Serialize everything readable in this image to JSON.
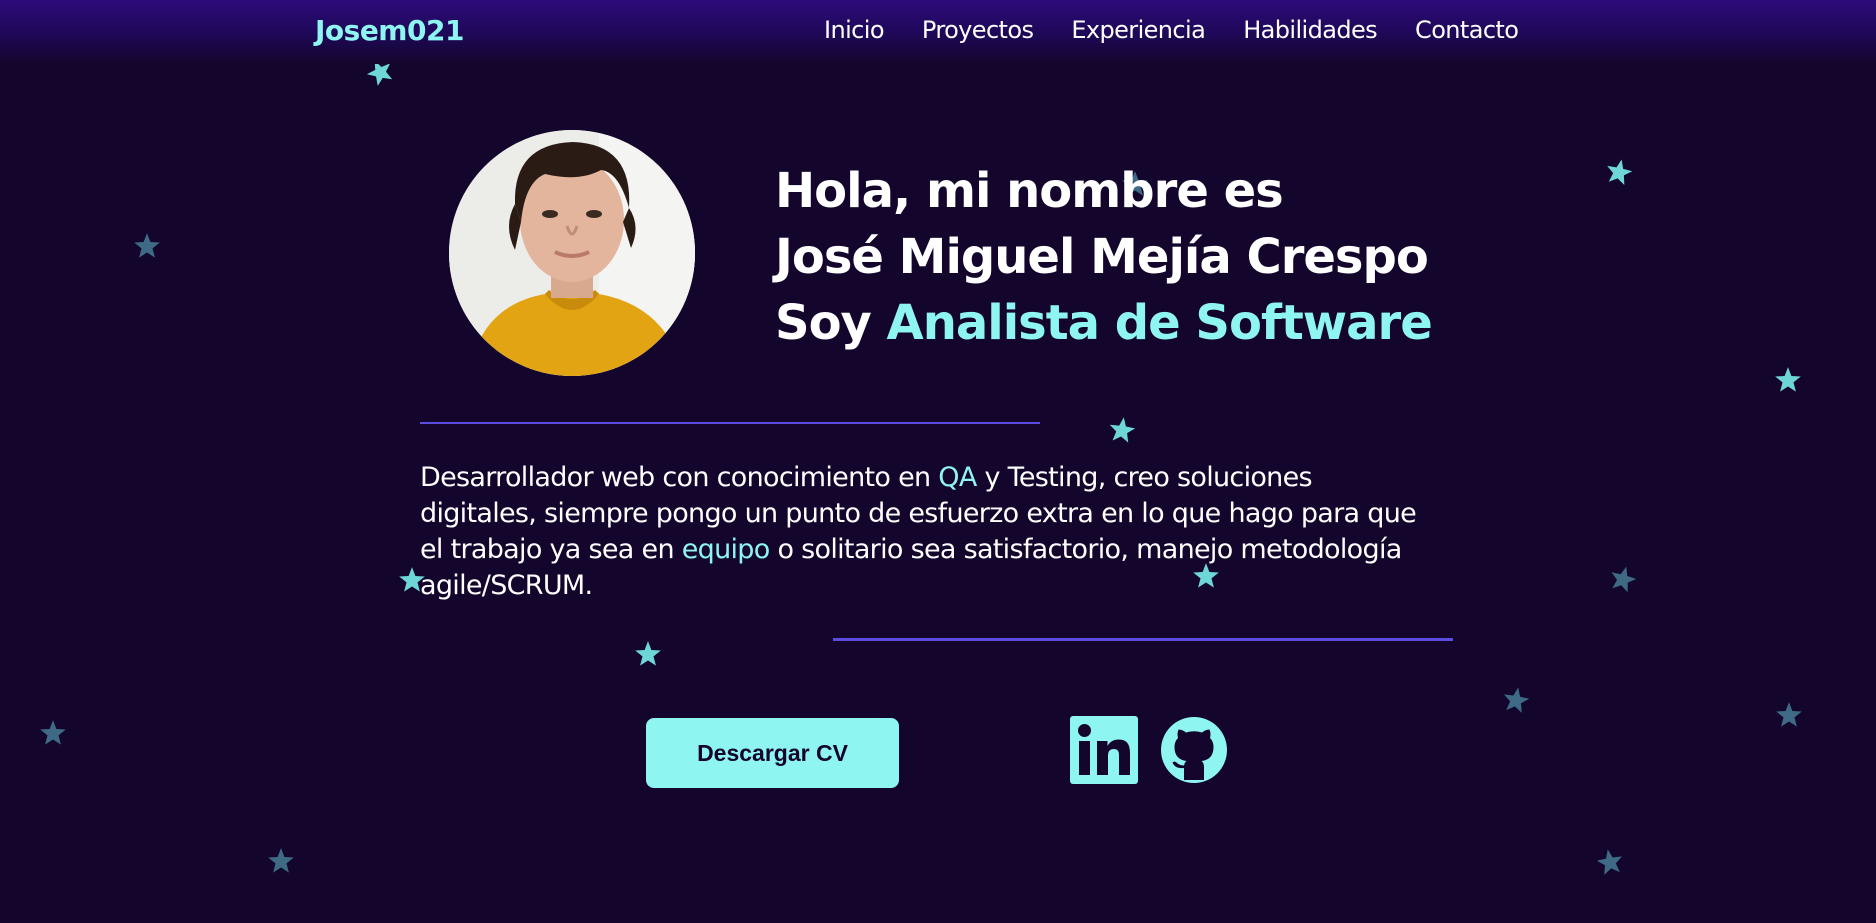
{
  "header": {
    "logo": "Josem021",
    "nav": [
      "Inicio",
      "Proyectos",
      "Experiencia",
      "Habilidades",
      "Contacto"
    ]
  },
  "hero": {
    "line1": "Hola, mi nombre es",
    "line2": "José Miguel Mejía Crespo",
    "line3_prefix": "Soy ",
    "line3_role": "Analista de Software"
  },
  "about": {
    "part1": "Desarrollador web con conocimiento en ",
    "hl1": "QA",
    "part2": " y Testing, creo soluciones digitales, siempre pongo un punto de esfuerzo extra en lo que hago para que el trabajo ya sea en ",
    "hl2": "equipo",
    "part3": " o solitario sea satisfactorio, manejo metodología agile/SCRUM."
  },
  "actions": {
    "cv_label": "Descargar CV"
  },
  "social": {
    "linkedin_icon": "linkedin-icon",
    "github_icon": "github-icon"
  },
  "colors": {
    "background": "#13052c",
    "accent": "#8ff5f0",
    "divider": "#5b4de0",
    "star_bright": "#6fd6d8",
    "star_dim": "#3e6a86"
  }
}
